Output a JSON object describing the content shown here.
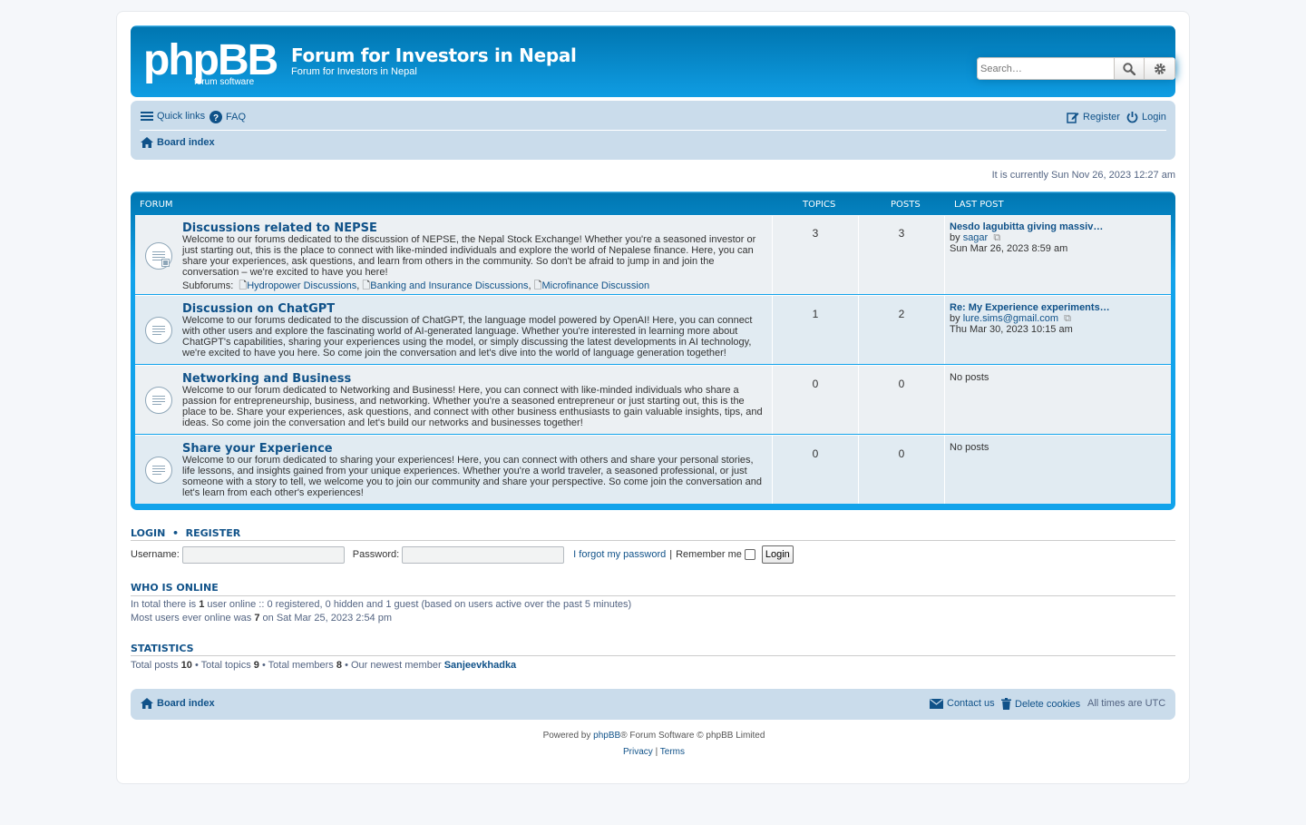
{
  "site": {
    "title": "Forum for Investors in Nepal",
    "description": "Forum for Investors in Nepal",
    "logo_text": "phpBB forum software"
  },
  "search": {
    "placeholder": "Search…"
  },
  "nav": {
    "quick_links": "Quick links",
    "faq": "FAQ",
    "register": "Register",
    "login": "Login",
    "board_index": "Board index"
  },
  "current_time": "It is currently Sun Nov 26, 2023 12:27 am",
  "forum_table": {
    "header": {
      "forum": "Forum",
      "topics": "Topics",
      "posts": "Posts",
      "last_post": "Last post"
    },
    "forums": [
      {
        "title": "Discussions related to NEPSE",
        "description": "Welcome to our forums dedicated to the discussion of NEPSE, the Nepal Stock Exchange! Whether you're a seasoned investor or just starting out, this is the place to connect with like-minded individuals and explore the world of Nepalese finance. Here, you can share your experiences, ask questions, and learn from others in the community. So don't be afraid to jump in and join the conversation – we're excited to have you here!",
        "subforums_label": "Subforums:",
        "subforums": [
          "Hydropower Discussions",
          "Banking and Insurance Discussions",
          "Microfinance Discussion"
        ],
        "topics": "3",
        "posts": "3",
        "last_title": "Nesdo lagubitta giving massiv…",
        "last_by": "by",
        "last_user": "sagar",
        "last_time": "Sun Mar 26, 2023 8:59 am"
      },
      {
        "title": "Discussion on ChatGPT",
        "description": "Welcome to our forums dedicated to the discussion of ChatGPT, the language model powered by OpenAI! Here, you can connect with other users and explore the fascinating world of AI-generated language. Whether you're interested in learning more about ChatGPT's capabilities, sharing your experiences using the model, or simply discussing the latest developments in AI technology, we're excited to have you here. So come join the conversation and let's dive into the world of language generation together!",
        "topics": "1",
        "posts": "2",
        "last_title": "Re: My Experience experiments…",
        "last_by": "by",
        "last_user": "lure.sims@gmail.com",
        "last_time": "Thu Mar 30, 2023 10:15 am"
      },
      {
        "title": "Networking and Business",
        "description": "Welcome to our forum dedicated to Networking and Business! Here, you can connect with like-minded individuals who share a passion for entrepreneurship, business, and networking. Whether you're a seasoned entrepreneur or just starting out, this is the place to be. Share your experiences, ask questions, and connect with other business enthusiasts to gain valuable insights, tips, and ideas. So come join the conversation and let's build our networks and businesses together!",
        "topics": "0",
        "posts": "0",
        "no_posts": "No posts"
      },
      {
        "title": "Share your Experience",
        "description": "Welcome to our forum dedicated to sharing your experiences! Here, you can connect with others and share your personal stories, life lessons, and insights gained from your unique experiences. Whether you're a world traveler, a seasoned professional, or just someone with a story to tell, we welcome you to join our community and share your perspective. So come join the conversation and let's learn from each other's experiences!",
        "topics": "0",
        "posts": "0",
        "no_posts": "No posts"
      }
    ]
  },
  "login_section": {
    "login_link": "Login",
    "separator": "•",
    "register_link": "Register",
    "username_label": "Username:",
    "password_label": "Password:",
    "forgot": "I forgot my password",
    "pipe": "|",
    "remember": "Remember me",
    "button": "Login"
  },
  "who_is_online": {
    "heading": "Who is online",
    "line1_pre": "In total there is",
    "line1_count": "1",
    "line1_post": "user online :: 0 registered, 0 hidden and 1 guest (based on users active over the past 5 minutes)",
    "line2_pre": "Most users ever online was",
    "line2_count": "7",
    "line2_post": "on Sat Mar 25, 2023 2:54 pm"
  },
  "statistics": {
    "heading": "Statistics",
    "total_posts_label": "Total posts",
    "total_posts": "10",
    "total_topics_label": "• Total topics",
    "total_topics": "9",
    "total_members_label": "• Total members",
    "total_members": "8",
    "newest_label": "• Our newest member",
    "newest_member": "Sanjeevkhadka"
  },
  "footer": {
    "board_index": "Board index",
    "contact": "Contact us",
    "delete_cookies": "Delete cookies",
    "timezone_label": "All times are",
    "timezone": "UTC",
    "powered_pre": "Powered by",
    "powered_link": "phpBB",
    "powered_post": "® Forum Software © phpBB Limited",
    "privacy": "Privacy",
    "pipe": "|",
    "terms": "Terms"
  },
  "colors": {
    "header_blue": "#12a3eb",
    "nav_bg": "#cadceb",
    "link": "#105289",
    "row_bg": "#ecf0f3",
    "row_alt_bg": "#e1ebf2"
  },
  "icons": [
    "search-icon",
    "gear-icon",
    "bars-icon",
    "question-icon",
    "pencil-icon",
    "power-icon",
    "home-icon",
    "forum-read-icon",
    "file-icon",
    "external-link-icon",
    "envelope-icon",
    "trash-icon"
  ]
}
